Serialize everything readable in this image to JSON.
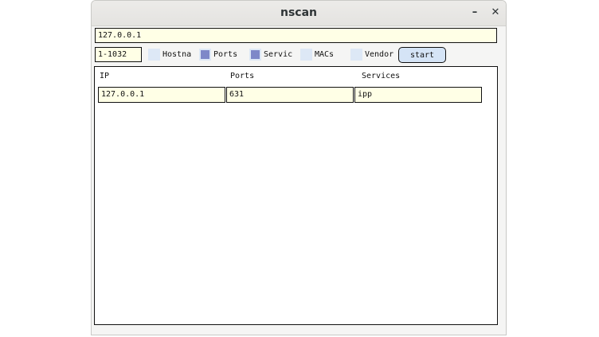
{
  "window": {
    "title": "nscan",
    "minimize_glyph": "–",
    "close_glyph": "✕"
  },
  "inputs": {
    "address": "127.0.0.1",
    "port_range": "1-1032"
  },
  "options": [
    {
      "label": "Hostna",
      "checked": false
    },
    {
      "label": "Ports",
      "checked": true
    },
    {
      "label": "Servic",
      "checked": true
    },
    {
      "label": "MACs",
      "checked": false
    },
    {
      "label": "Vendor",
      "checked": false
    }
  ],
  "start_button": "start",
  "results": {
    "columns": [
      "IP",
      "Ports",
      "Services"
    ],
    "rows": [
      [
        "127.0.0.1",
        "631",
        "ipp"
      ]
    ]
  },
  "colors": {
    "input_bg": "#ffffe6",
    "checkbox_bg": "#dde8f6",
    "checkbox_check": "#7e88c8",
    "button_bg": "#d5e4f6"
  }
}
